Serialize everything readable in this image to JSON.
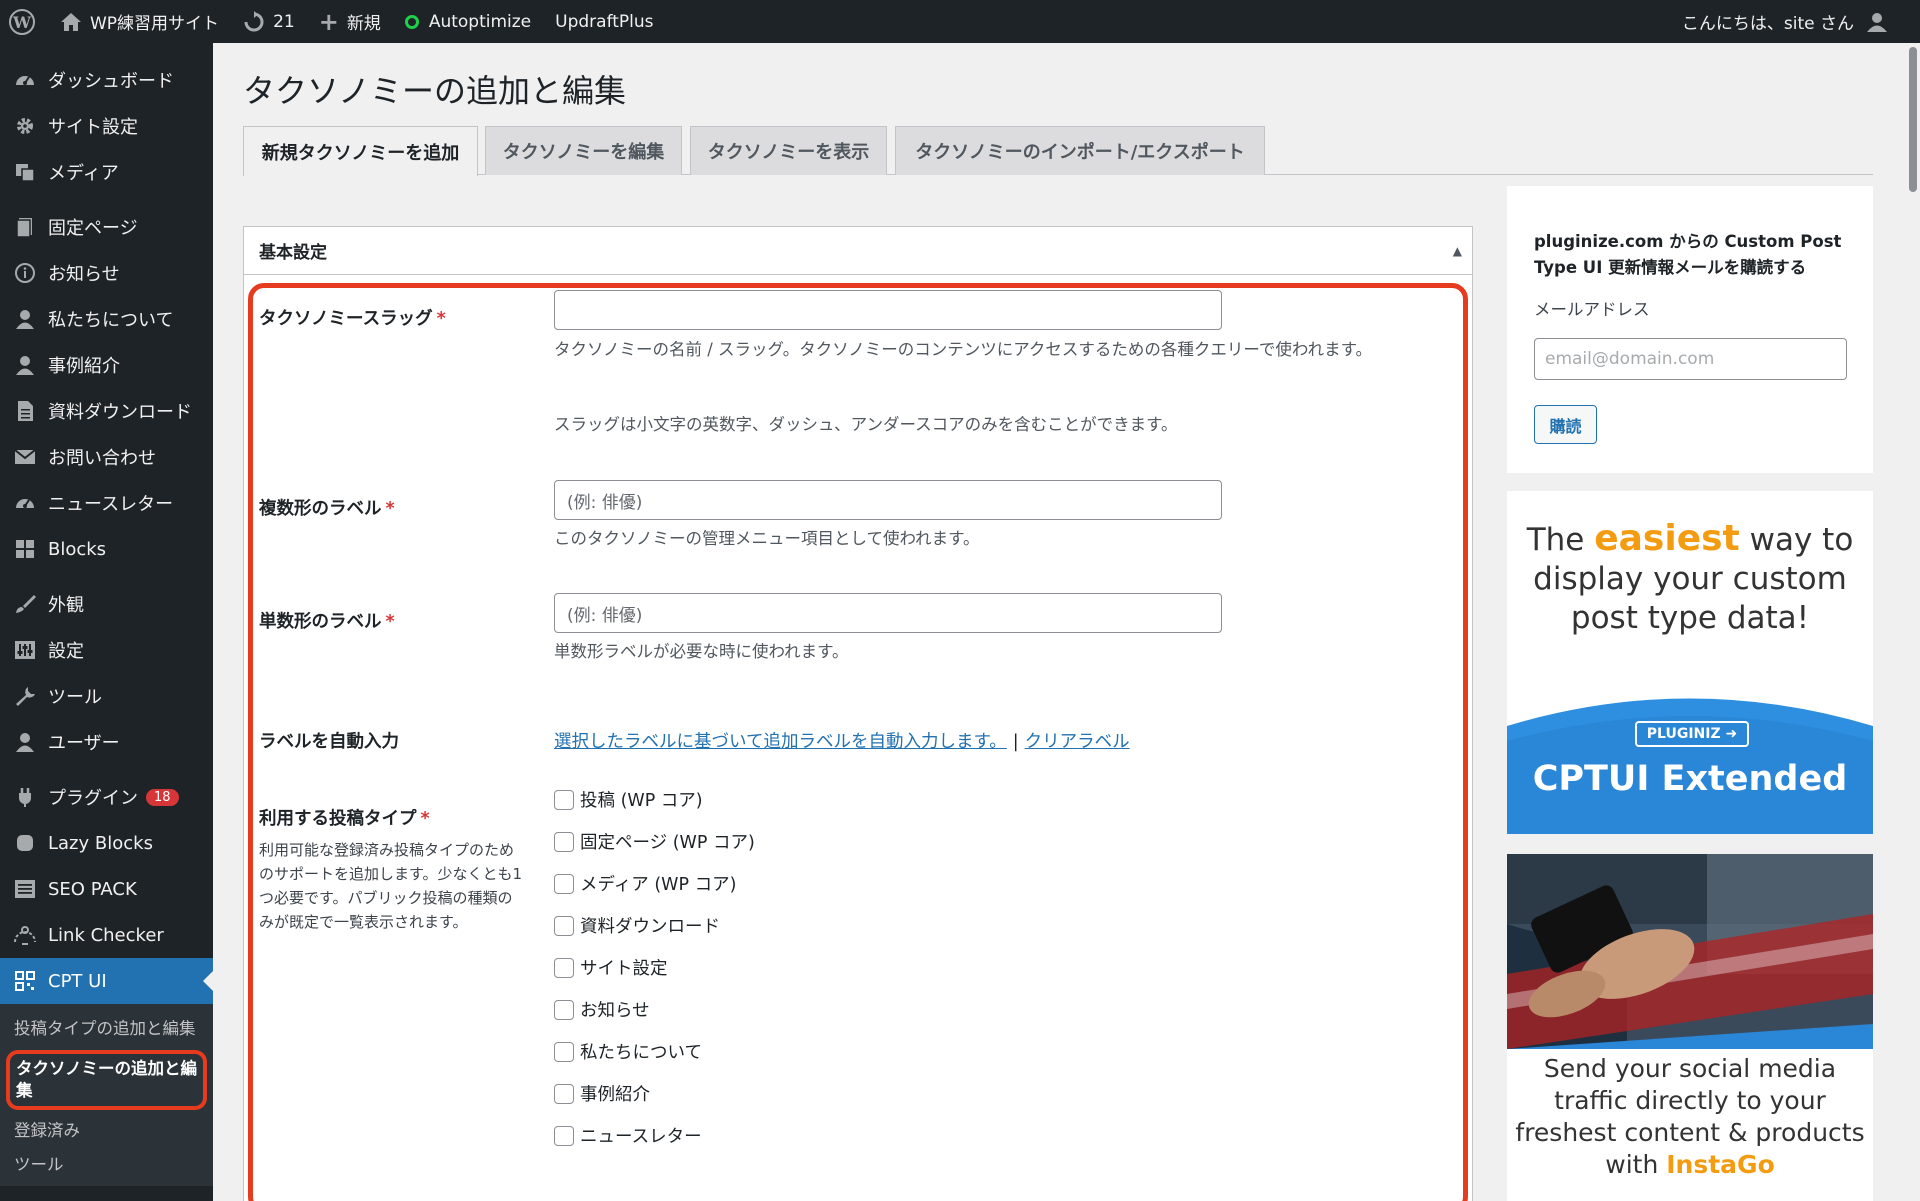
{
  "adminbar": {
    "site_name": "WP練習用サイト",
    "updates_count": "21",
    "new_label": "新規",
    "autoptimize": "Autoptimize",
    "updraft": "UpdraftPlus",
    "greeting": "こんにちは、site さん"
  },
  "menu": {
    "items": [
      {
        "label": "ダッシュボード",
        "icon": "dashboard-icon"
      },
      {
        "label": "サイト設定",
        "icon": "gear-icon"
      },
      {
        "label": "メディア",
        "icon": "media-icon"
      },
      {
        "label": "固定ページ",
        "icon": "page-icon"
      },
      {
        "label": "お知らせ",
        "icon": "info-icon"
      },
      {
        "label": "私たちについて",
        "icon": "person-icon"
      },
      {
        "label": "事例紹介",
        "icon": "person-icon"
      },
      {
        "label": "資料ダウンロード",
        "icon": "document-icon"
      },
      {
        "label": "お問い合わせ",
        "icon": "mail-icon"
      },
      {
        "label": "ニュースレター",
        "icon": "dashboard-icon"
      },
      {
        "label": "Blocks",
        "icon": "grid-icon"
      },
      {
        "label": "外観",
        "icon": "brush-icon"
      },
      {
        "label": "設定",
        "icon": "settings-panel-icon"
      },
      {
        "label": "ツール",
        "icon": "wrench-icon"
      },
      {
        "label": "ユーザー",
        "icon": "user-icon"
      },
      {
        "label": "プラグイン",
        "icon": "plugin-icon",
        "badge": "18"
      },
      {
        "label": "Lazy Blocks",
        "icon": "block-icon"
      },
      {
        "label": "SEO PACK",
        "icon": "list-icon"
      },
      {
        "label": "Link Checker",
        "icon": "link-checker-icon"
      },
      {
        "label": "CPT UI",
        "icon": "cptui-icon"
      }
    ],
    "submenu": [
      {
        "label": "投稿タイプの追加と編集"
      },
      {
        "label": "タクソノミーの追加と編集"
      },
      {
        "label": "登録済み"
      },
      {
        "label": "ツール"
      }
    ]
  },
  "page": {
    "title": "タクソノミーの追加と編集",
    "tabs": [
      {
        "label": "新規タクソノミーを追加"
      },
      {
        "label": "タクソノミーを編集"
      },
      {
        "label": "タクソノミーを表示"
      },
      {
        "label": "タクソノミーのインポート/エクスポート"
      }
    ]
  },
  "basic": {
    "header": "基本設定",
    "slug_label": "タクソノミースラッグ",
    "required_mark": "*",
    "slug_value": "",
    "slug_desc1": "タクソノミーの名前 / スラッグ。タクソノミーのコンテンツにアクセスするための各種クエリーで使われます。",
    "slug_desc2": "スラッグは小文字の英数字、ダッシュ、アンダースコアのみを含むことができます。",
    "plural_label": "複数形のラベル",
    "plural_placeholder": "(例: 俳優)",
    "plural_desc": "このタクソノミーの管理メニュー項目として使われます。",
    "singular_label": "単数形のラベル",
    "singular_placeholder": "(例: 俳優)",
    "singular_desc": "単数形ラベルが必要な時に使われます。",
    "autofill_label": "ラベルを自動入力",
    "autofill_link": "選択したラベルに基づいて追加ラベルを自動入力します。",
    "autofill_sep": "|",
    "clear_link": "クリアラベル",
    "post_types_label": "利用する投稿タイプ",
    "post_types_desc": "利用可能な登録済み投稿タイプのためのサポートを追加します。少なくとも1つ必要です。パブリック投稿の種類のみが既定で一覧表示されます。",
    "post_types": [
      {
        "label": "投稿 (WP コア)"
      },
      {
        "label": "固定ページ (WP コア)"
      },
      {
        "label": "メディア (WP コア)"
      },
      {
        "label": "資料ダウンロード"
      },
      {
        "label": "サイト設定"
      },
      {
        "label": "お知らせ"
      },
      {
        "label": "私たちについて"
      },
      {
        "label": "事例紹介"
      },
      {
        "label": "ニュースレター"
      }
    ]
  },
  "sidebar": {
    "news_title": "pluginize.com からの Custom Post Type UI 更新情報メールを購読する",
    "email_label": "メールアドレス",
    "email_placeholder": "email@domain.com",
    "subscribe": "購読",
    "ad1_pre": "The",
    "ad1_highlight": "easiest",
    "ad1_post": "way to display your custom post type data!",
    "ad1_logo": "PLUGINIZ",
    "ad1_title": "CPTUI Extended",
    "ad2_text": "Send your social media traffic directly to your freshest content & products with",
    "ad2_highlight": "InstaGo"
  },
  "colors": {
    "accent": "#2271b1",
    "highlight": "#e63b1f",
    "adminbar": "#1d2327"
  }
}
